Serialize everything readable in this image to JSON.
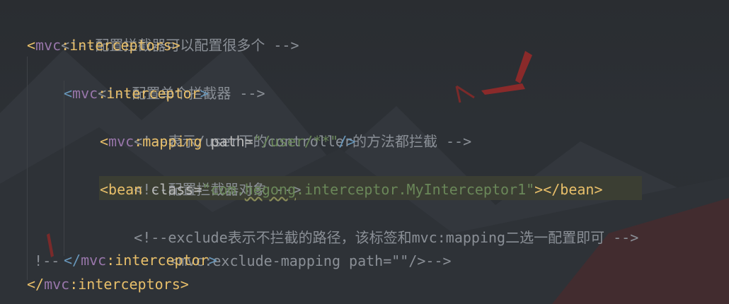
{
  "code": {
    "lines": [
      {
        "comment": "<!--配置拦截器可以配置很多个 -->"
      },
      {
        "lt": "<",
        "ns": "mvc",
        "colon": ":",
        "tag": "interceptors",
        "gt": ">"
      },
      {
        "comment": "<!--配置单个拦截器 -->"
      },
      {
        "lt": "<",
        "ns": "mvc",
        "colon": ":",
        "tag": "interceptor",
        "gt": ">"
      },
      {
        "comment": "<!--表示/user下的controller的方法都拦截 -->"
      },
      {
        "lt": "<",
        "ns": "mvc",
        "colon": ":",
        "tag": "mapping",
        "attr": "path",
        "eq": "=",
        "value": "\"/user/**\"",
        "close": "/>"
      },
      {
        "comment": "<!--配置拦截器对象 -->"
      },
      {
        "lt": "<",
        "tag": "bean",
        "attr": "class",
        "eq": "=",
        "value_prefix": "\"com.",
        "value_squiggle": "hegong",
        "value_suffix": ".interceptor.MyInterceptor1\"",
        "gt": ">",
        "close_lt": "</",
        "close_tag": "bean",
        "close_gt": ">"
      },
      {
        "comment": "<!--exclude表示不拦截的路径，该标签和mvc:mapping二选一配置即可 -->"
      },
      {
        "prefix": "!--",
        "comment": "<mvc:exclude-mapping path=\"\"/>-->"
      },
      {
        "close_lt": "</",
        "ns": "mvc",
        "colon": ":",
        "tag": "interceptor",
        "gt": ">"
      },
      {
        "close_lt": "</",
        "ns": "mvc",
        "colon": ":",
        "tag": "interceptors",
        "gt": ">"
      }
    ]
  },
  "colors": {
    "background": "#2b2f34",
    "comment": "#8a8f96",
    "tag": "#e8bf6a",
    "namespace": "#9876aa",
    "string": "#6a8759",
    "highlight": "#3b3e33"
  }
}
